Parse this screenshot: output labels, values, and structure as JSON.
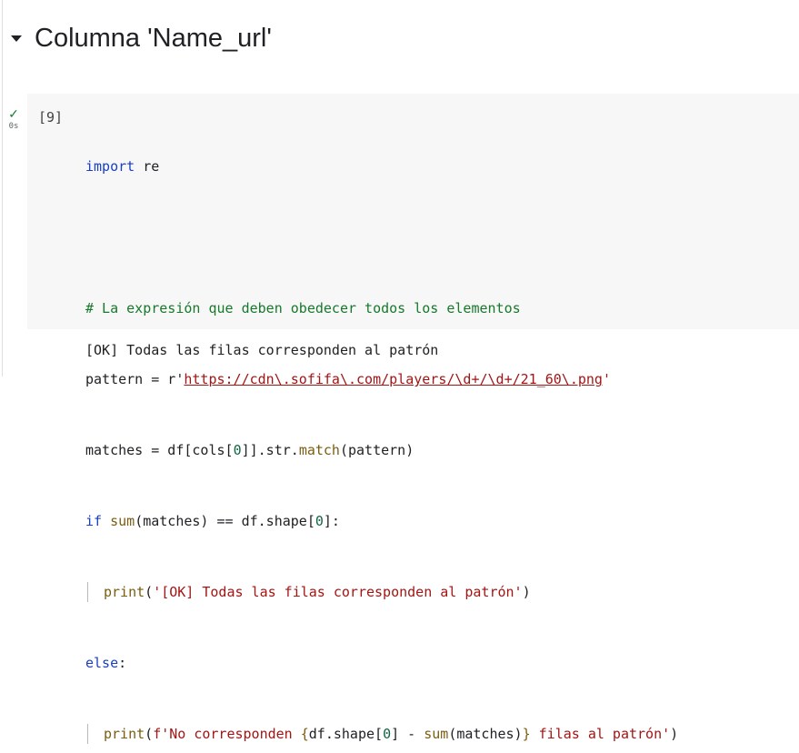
{
  "section": {
    "title": "Columna 'Name_url'",
    "collapse_icon": "caret-down-icon"
  },
  "cell": {
    "status_icon": "check-icon",
    "status_symbol": "✓",
    "exec_time": "0s",
    "exec_count": "[9]",
    "code": {
      "l1_kw": "import",
      "l1_rest": " re",
      "l3_comment": "# La expresión que deben obedecer todos los elementos",
      "l4_a": "pattern = r'",
      "l4_url": "https://cdn\\.sofifa\\.com/players/\\d+/\\d+/21_60\\.png",
      "l4_end": "'",
      "l5_a": "matches = df[cols[",
      "l5_num": "0",
      "l5_b": "]].str.",
      "l5_fn": "match",
      "l5_c": "(pattern)",
      "l6_kw": "if",
      "l6_sp": " ",
      "l6_fn": "sum",
      "l6_b": "(matches) == df.shape[",
      "l6_num": "0",
      "l6_c": "]:",
      "l7_fn": "print",
      "l7_a": "(",
      "l7_str": "'[OK] Todas las filas corresponden al patrón'",
      "l7_b": ")",
      "l8_kw": "else",
      "l8_b": ":",
      "l9_fn": "print",
      "l9_a": "(",
      "l9_s1": "f'No corresponden ",
      "l9_b1": "{",
      "l9_b2": "df.shape[",
      "l9_n": "0",
      "l9_b3": "] - ",
      "l9_fn2": "sum",
      "l9_b4": "(matches)",
      "l9_b5": "}",
      "l9_s2": " filas al patrón'",
      "l9_end": ")"
    },
    "output": "[OK] Todas las filas corresponden al patrón"
  },
  "colors": {
    "keyword": "#1a3fbf",
    "function": "#7a5d11",
    "comment": "#16792c",
    "string": "#a31515",
    "number": "#116644",
    "cell_bg": "#f7f7f7",
    "check": "#188038"
  }
}
